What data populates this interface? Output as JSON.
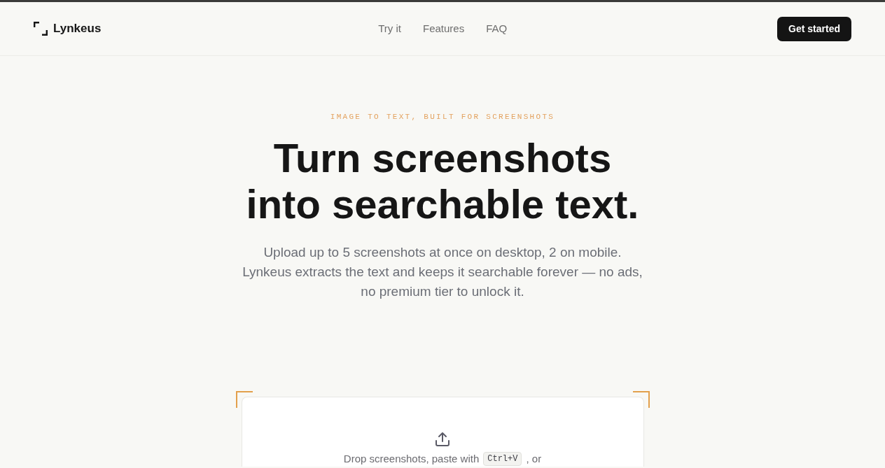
{
  "header": {
    "brand": "Lynkeus",
    "nav": [
      {
        "label": "Try it"
      },
      {
        "label": "Features"
      },
      {
        "label": "FAQ"
      }
    ],
    "cta": "Get started"
  },
  "hero": {
    "eyebrow": "IMAGE TO TEXT, BUILT FOR SCREENSHOTS",
    "title": "Turn screenshots into searchable text.",
    "description": "Upload up to 5 screenshots at once on desktop, 2 on mobile. Lynkeus extracts the text and keeps it searchable forever — no ads, no premium tier to unlock it."
  },
  "upload": {
    "prompt": [
      {
        "kind": "text",
        "text": "Drop screenshots, paste with"
      },
      {
        "kind": "key",
        "text": "Ctrl+V"
      },
      {
        "kind": "text",
        "text": ", or"
      }
    ]
  }
}
